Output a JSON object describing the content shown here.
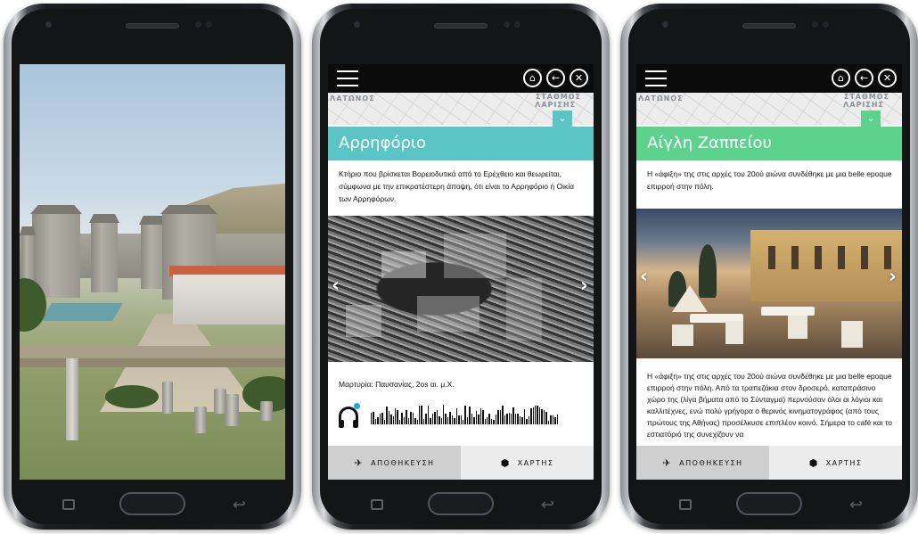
{
  "phones": [
    {
      "id": "phone1"
    },
    {
      "id": "phone2",
      "map_labels": [
        "ΛΑΤΩΝΟΣ",
        "ΣΤΑΘΜΟΣ",
        "ΛΑΡΙΣΗΣ"
      ],
      "title": "Αρρηφόριο",
      "title_color": "#5bc4c4",
      "description": "Κτήριο που βρίσκεται Βορειοδυτικά από το Ερέχθειο και θεωρείται, σύμφωνα με την επικρατέστερη άποψη, ότι είναι το Αρρηφόριο ή Οικία των Αρρηφόρων.",
      "caption": "Μαρτυρία: Παυσανίας, 2os αι. μ.Χ.",
      "audio_icon": "headphones-icon",
      "save_label": "ΑΠΟΘΗΚΕΥΣΗ",
      "map_label": "ΧΑΡΤΗΣ"
    },
    {
      "id": "phone3",
      "map_labels": [
        "ΛΑΤΩΝΟΣ",
        "ΣΤΑΘΜΟΣ",
        "ΛΑΡΙΣΗΣ"
      ],
      "title": "Αίγλη Ζαππείου",
      "title_color": "#5dd28c",
      "description": "Η «άφιξη» της στις αρχές του 20ού αιώνα συνδέθηκε με μια belle epoque επιρροή στην πόλη.",
      "body": "Η «άφιξη» της στις αρχές του 20ού αιώνα συνδέθηκε με μια belle epoque επιρροή στην πόλη. Από τα τραπεζάκια στον δροσερό, καταπράσινο χώρο της (λίγα βήματα από το Σύνταγμα) περνούσαν όλοι οι λόγιοι και καλλιτέχνες, ενώ πολύ γρήγορα ο θερινός κινηματογράφος (από τους πρώτους της Αθήνας) προσέλκυσε επιπλέον κοινό. Σήμερα το café και το εστιατόριό της συνεχίζουν να",
      "save_label": "ΑΠΟΘΗΚΕΥΣΗ",
      "map_label": "ΧΑΡΤΗΣ"
    }
  ]
}
